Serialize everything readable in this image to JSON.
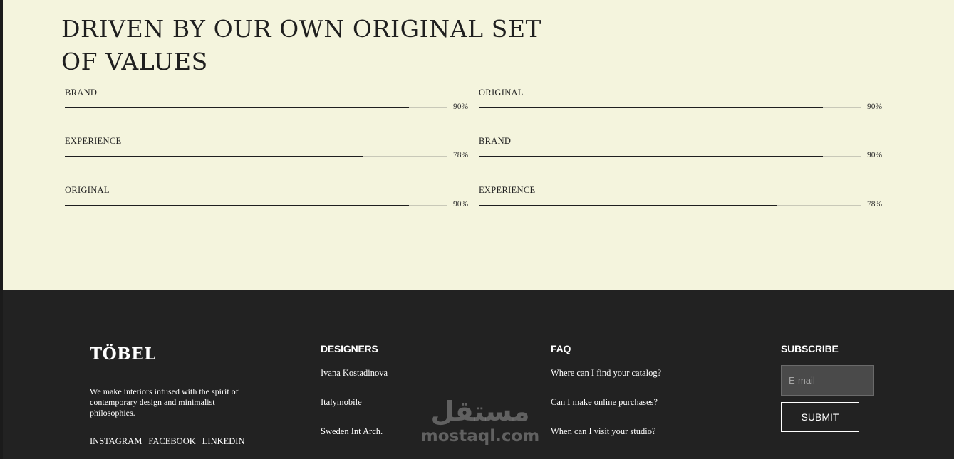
{
  "values": {
    "title": "DRIVEN BY OUR OWN ORIGINAL SET OF VALUES",
    "skills_left": [
      {
        "label": "BRAND",
        "percent_label": "90%",
        "value": 90
      },
      {
        "label": "EXPERIENCE",
        "percent_label": "78%",
        "value": 78
      },
      {
        "label": "ORIGINAL",
        "percent_label": "90%",
        "value": 90
      }
    ],
    "skills_right": [
      {
        "label": "ORIGINAL",
        "percent_label": "90%",
        "value": 90
      },
      {
        "label": "BRAND",
        "percent_label": "90%",
        "value": 90
      },
      {
        "label": "EXPERIENCE",
        "percent_label": "78%",
        "value": 78
      }
    ]
  },
  "footer": {
    "brand": "TÖBEL",
    "description": "We make interiors infused with the spirit of contemporary design and minimalist philosophies.",
    "social": [
      "INSTAGRAM",
      "FACEBOOK",
      "LINKEDIN"
    ],
    "designers": {
      "heading": "DESIGNERS",
      "links": [
        "Ivana Kostadinova",
        "Italymobile",
        "Sweden Int Arch."
      ]
    },
    "faq": {
      "heading": "FAQ",
      "links": [
        "Where can I find your catalog?",
        "Can I make online purchases?",
        "When can I visit your studio?"
      ]
    },
    "subscribe": {
      "heading": "SUBSCRIBE",
      "email_placeholder": "E-mail",
      "button_label": "SUBMIT"
    }
  },
  "watermark": {
    "arabic": "مستقل",
    "latin": "mostaql.com"
  },
  "colors": {
    "section_bg": "#f4f4dd",
    "footer_bg": "#222222",
    "bar_fill": "#1f1f1f",
    "bar_track": "#c8c8b8"
  }
}
